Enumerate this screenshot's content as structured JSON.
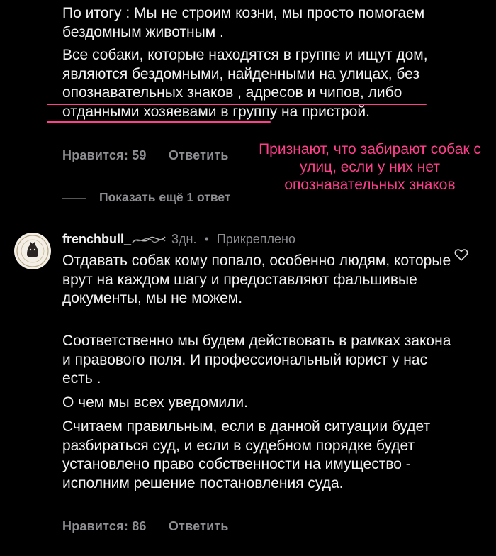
{
  "comment1": {
    "paragraphs": [
      "По итогу : Мы не строим козни, мы просто помогаем бездомным животным .",
      "Все собаки, которые находятся в группе и ищут дом, являются бездомными, найденными на улицах, без опознавательных знаков , адресов и чипов, либо отданными хозяевами в группу на пристрой."
    ],
    "likes_label": "Нравится: 59",
    "reply_label": "Ответить"
  },
  "show_more_replies": "Показать ещё 1 ответ",
  "annotation": {
    "text": "Признают, что забирают собак с улиц, если у них нет опознавательных знаков",
    "color": "#ff3f8c"
  },
  "comment2": {
    "username": "frenchbull_",
    "time": "3дн.",
    "separator": "•",
    "pinned_label": "Прикреплено",
    "paragraphs": [
      "Отдавать собак кому попало, особенно людям, которые врут на каждом шагу и предоставляют фальшивые документы, мы не можем.",
      "Соответственно мы будем действовать в рамках закона и правового поля. И профессиональный юрист у нас есть .",
      "О чем мы всех уведомили.",
      "Считаем правильным, если в данной ситуации будет разбираться суд, и если в судебном порядке будет установлено право собственности на имущество - исполним решение постановления суда."
    ],
    "likes_label": "Нравится: 86",
    "reply_label": "Ответить",
    "icons": {
      "like": "heart-icon",
      "avatar": "frenchbull-logo"
    }
  },
  "colors": {
    "background": "#000000",
    "text": "#f3f3f3",
    "muted": "#8e8e93",
    "accent": "#ff3f8c"
  }
}
